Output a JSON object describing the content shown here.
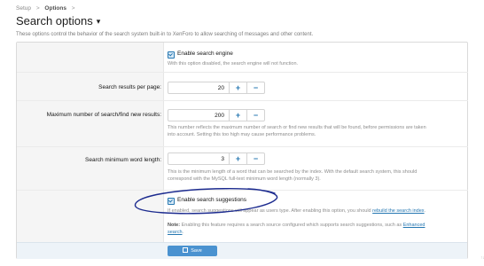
{
  "breadcrumb": {
    "items": [
      "Setup",
      "Options"
    ],
    "separator": ">"
  },
  "page": {
    "title": "Search options",
    "caret": "▾",
    "description": "These options control the behavior of the search system built-in to XenForo to allow searching of messages and other content."
  },
  "options": {
    "enable_search_engine": {
      "label": "Enable search engine",
      "help": "With this option disabled, the search engine will not function.",
      "checked": true
    },
    "results_per_page": {
      "label": "Search results per page:",
      "value": "20"
    },
    "max_find_new": {
      "label": "Maximum number of search/find new results:",
      "value": "200",
      "help_line1": "This number reflects the maximum number of search or find new results that will be found, before permissions are taken",
      "help_line2": "into account. Setting this too high may cause performance problems."
    },
    "min_word_length": {
      "label": "Search minimum word length:",
      "value": "3",
      "help_line1": "This is the minimum length of a word that can be searched by the index. With the default search system, this should",
      "help_line2": "correspond with the MySQL full-text minimum word length (normally 3)."
    },
    "suggestions": {
      "label": "Enable search suggestions",
      "checked": true,
      "help_before": "If enabled, search suggestions will appear as users type. After enabling this option, you should ",
      "help_link": "rebuild the search index",
      "help_after": ".",
      "note_label": "Note:",
      "note_text": " Enabling this feature requires a search source configured which supports search suggestions, such as ",
      "note_link_1": "Enhanced",
      "note_link_2": "search",
      "note_after": "."
    }
  },
  "buttons": {
    "plus": "+",
    "minus": "−",
    "save": "Save"
  },
  "side_mark": "↑↓",
  "colors": {
    "accent": "#2577b1",
    "save_button": "#4a92d0",
    "annotation_ink": "#1c2b8f"
  }
}
